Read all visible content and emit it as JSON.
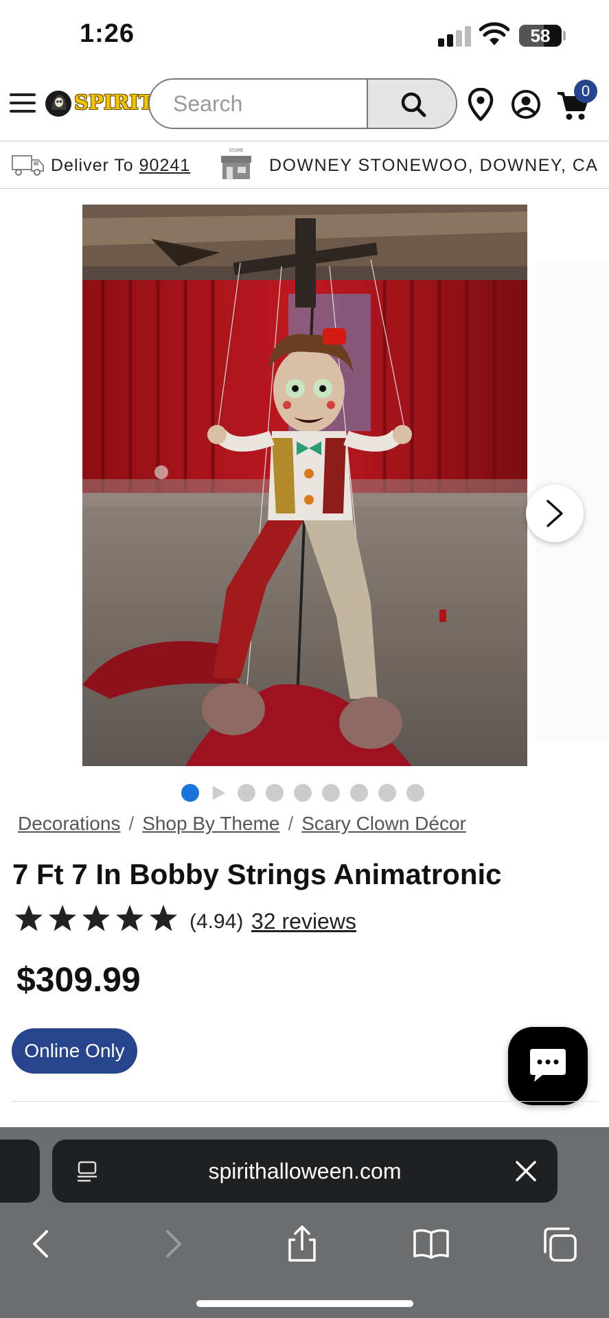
{
  "status_bar": {
    "time": "1:26",
    "battery": "58",
    "battery_fraction": 0.58
  },
  "header": {
    "logo_text": "SPIRIT",
    "search_placeholder": "Search",
    "cart_count": "0"
  },
  "delivery": {
    "label": "Deliver To ",
    "zip": "90241",
    "store_icon_label": "STORE",
    "store_name": "DOWNEY STONEWOO, DOWNEY, CA"
  },
  "gallery": {
    "image_count": 9,
    "active_index": 0,
    "video_index": 1
  },
  "breadcrumb": {
    "items": [
      "Decorations",
      "Shop By Theme",
      "Scary Clown Décor"
    ],
    "separator": "/"
  },
  "product": {
    "title": "7 Ft 7 In Bobby Strings Animatronic",
    "stars": 5,
    "rating": "(4.94)",
    "reviews": "32 reviews",
    "price": "$309.99",
    "badge": "Online Only"
  },
  "browser": {
    "url": "spirithalloween.com"
  },
  "colors": {
    "brand_blue": "#27458d",
    "active_dot": "#1a73d9",
    "browser_bg": "#6b6d6f",
    "url_bar_bg": "#1f2022"
  }
}
